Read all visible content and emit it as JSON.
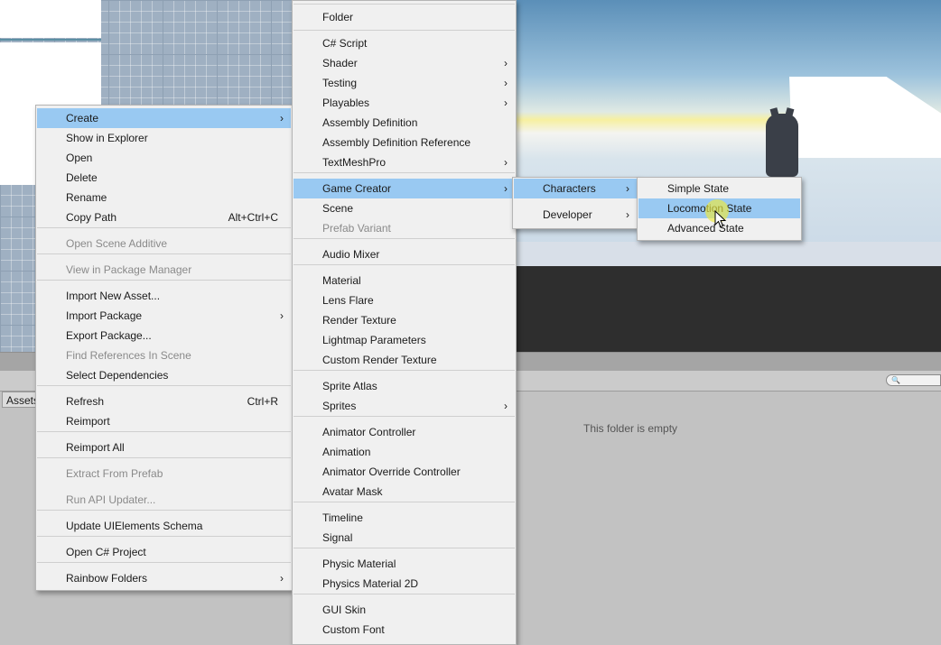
{
  "context_menu": {
    "items": [
      {
        "label": "Create",
        "highlighted": true,
        "submenu": true
      },
      {
        "label": "Show in Explorer"
      },
      {
        "label": "Open"
      },
      {
        "label": "Delete"
      },
      {
        "label": "Rename"
      },
      {
        "label": "Copy Path",
        "shortcut": "Alt+Ctrl+C"
      },
      {
        "label": "Open Scene Additive",
        "disabled": true
      },
      {
        "label": "View in Package Manager",
        "disabled": true
      },
      {
        "label": "Import New Asset..."
      },
      {
        "label": "Import Package",
        "submenu": true
      },
      {
        "label": "Export Package..."
      },
      {
        "label": "Find References In Scene",
        "disabled": true
      },
      {
        "label": "Select Dependencies"
      },
      {
        "label": "Refresh",
        "shortcut": "Ctrl+R"
      },
      {
        "label": "Reimport"
      },
      {
        "label": "Reimport All"
      },
      {
        "label": "Extract From Prefab",
        "disabled": true
      },
      {
        "label": "Run API Updater...",
        "disabled": true
      },
      {
        "label": "Update UIElements Schema"
      },
      {
        "label": "Open C# Project"
      },
      {
        "label": "Rainbow Folders",
        "submenu": true
      }
    ]
  },
  "create_menu": {
    "items": [
      {
        "label": "Folder"
      },
      {
        "label": "C# Script"
      },
      {
        "label": "Shader",
        "submenu": true
      },
      {
        "label": "Testing",
        "submenu": true
      },
      {
        "label": "Playables",
        "submenu": true
      },
      {
        "label": "Assembly Definition"
      },
      {
        "label": "Assembly Definition Reference"
      },
      {
        "label": "TextMeshPro",
        "submenu": true
      },
      {
        "label": "Game Creator",
        "highlighted": true,
        "submenu": true
      },
      {
        "label": "Scene"
      },
      {
        "label": "Prefab Variant",
        "disabled": true
      },
      {
        "label": "Audio Mixer"
      },
      {
        "label": "Material"
      },
      {
        "label": "Lens Flare"
      },
      {
        "label": "Render Texture"
      },
      {
        "label": "Lightmap Parameters"
      },
      {
        "label": "Custom Render Texture"
      },
      {
        "label": "Sprite Atlas"
      },
      {
        "label": "Sprites",
        "submenu": true
      },
      {
        "label": "Animator Controller"
      },
      {
        "label": "Animation"
      },
      {
        "label": "Animator Override Controller"
      },
      {
        "label": "Avatar Mask"
      },
      {
        "label": "Timeline"
      },
      {
        "label": "Signal"
      },
      {
        "label": "Physic Material"
      },
      {
        "label": "Physics Material 2D"
      },
      {
        "label": "GUI Skin"
      },
      {
        "label": "Custom Font"
      }
    ]
  },
  "game_creator_menu": {
    "items": [
      {
        "label": "Characters",
        "highlighted": true,
        "submenu": true
      },
      {
        "label": "Developer",
        "submenu": true
      }
    ]
  },
  "characters_menu": {
    "items": [
      {
        "label": "Simple State"
      },
      {
        "label": "Locomotion State",
        "highlighted": true
      },
      {
        "label": "Advanced State"
      }
    ]
  },
  "project": {
    "assets_tab": "Assets",
    "empty_message": "This folder is empty",
    "search_icon": "🔍"
  },
  "arrow_glyph": "›"
}
